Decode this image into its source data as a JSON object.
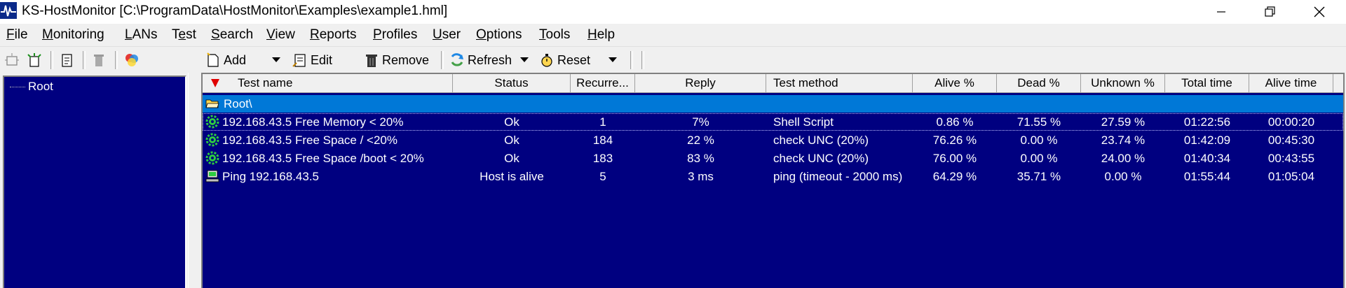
{
  "window": {
    "title": "KS-HostMonitor  [C:\\ProgramData\\HostMonitor\\Examples\\example1.hml]",
    "controls": [
      "minimize-icon",
      "restore-icon",
      "close-icon"
    ]
  },
  "menu": [
    {
      "label": "File",
      "u": "F",
      "rest": "ile"
    },
    {
      "label": "Monitoring",
      "u": "M",
      "rest": "onitoring"
    },
    {
      "label": "LANs",
      "u": "L",
      "rest": "ANs"
    },
    {
      "label": "Test",
      "pre": "T",
      "u": "e",
      "rest": "st"
    },
    {
      "label": "Search",
      "u": "S",
      "rest": "earch"
    },
    {
      "label": "View",
      "u": "V",
      "rest": "iew"
    },
    {
      "label": "Reports",
      "u": "R",
      "rest": "eports"
    },
    {
      "label": "Profiles",
      "u": "P",
      "rest": "rofiles"
    },
    {
      "label": "User",
      "u": "U",
      "rest": "ser"
    },
    {
      "label": "Options",
      "u": "O",
      "rest": "ptions"
    },
    {
      "label": "Tools",
      "u": "T",
      "rest": "ools"
    },
    {
      "label": "Help",
      "u": "H",
      "rest": "elp"
    }
  ],
  "toolbar": {
    "add": "Add",
    "edit": "Edit",
    "remove": "Remove",
    "refresh": "Refresh",
    "reset": "Reset"
  },
  "tree": {
    "root": "Root"
  },
  "grid": {
    "columns": [
      "Test name",
      "Status",
      "Recurre...",
      "Reply",
      "Test method",
      "Alive %",
      "Dead %",
      "Unknown %",
      "Total time",
      "Alive time"
    ],
    "folder": "Root\\",
    "rows": [
      {
        "name": "192.168.43.5 Free Memory < 20%",
        "status": "Ok",
        "recurrence": "1",
        "reply": "7%",
        "method": "Shell Script",
        "alive": "0.86 %",
        "dead": "71.55 %",
        "unknown": "27.59 %",
        "total": "01:22:56",
        "alive_time": "00:00:20",
        "icon": "gear-icon"
      },
      {
        "name": "192.168.43.5 Free Space / <20%",
        "status": "Ok",
        "recurrence": "184",
        "reply": "22 %",
        "method": "check UNC (20%)",
        "alive": "76.26 %",
        "dead": "0.00 %",
        "unknown": "23.74 %",
        "total": "01:42:09",
        "alive_time": "00:45:30",
        "icon": "gear-icon"
      },
      {
        "name": "192.168.43.5 Free Space /boot < 20%",
        "status": "Ok",
        "recurrence": "183",
        "reply": "83 %",
        "method": "check UNC (20%)",
        "alive": "76.00 %",
        "dead": "0.00 %",
        "unknown": "24.00 %",
        "total": "01:40:34",
        "alive_time": "00:43:55",
        "icon": "gear-icon"
      },
      {
        "name": "Ping 192.168.43.5",
        "status": "Host is alive",
        "recurrence": "5",
        "reply": "3 ms",
        "method": "ping (timeout - 2000 ms)",
        "alive": "64.29 %",
        "dead": "35.71 %",
        "unknown": "0.00 %",
        "total": "01:55:44",
        "alive_time": "01:05:04",
        "icon": "computer-icon"
      }
    ]
  },
  "colors": {
    "grid_bg": "#000080",
    "selection": "#0078d7",
    "ok_icon": "#2ecc40"
  }
}
